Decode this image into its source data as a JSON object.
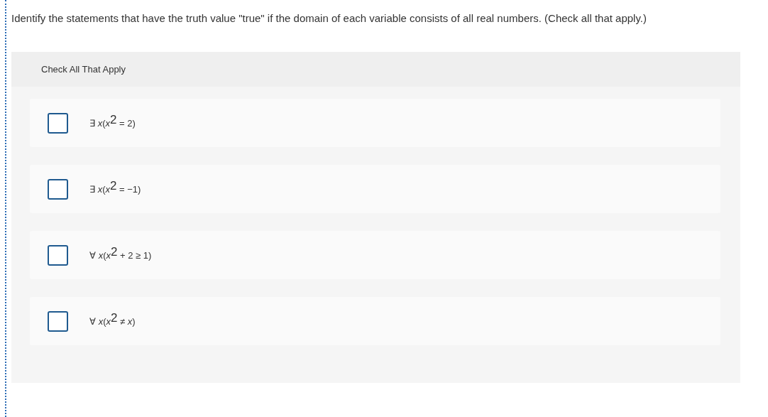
{
  "question": "Identify the statements that have the truth value \"true\" if the domain of each variable consists of all real numbers. (Check all that apply.)",
  "panel": {
    "header": "Check All That Apply",
    "options": [
      {
        "label": "∃ *x*(*x*$^{2}$ = 2)",
        "checked": false
      },
      {
        "label": "∃ *x*(*x*$^{2}$ = −1)",
        "checked": false
      },
      {
        "label": "∀ *x*(*x*$^{2}$ + 2 ≥ 1)",
        "checked": false
      },
      {
        "label": "∀ *x*(*x*$^{2}$ ≠ *x*)",
        "checked": false
      }
    ]
  }
}
